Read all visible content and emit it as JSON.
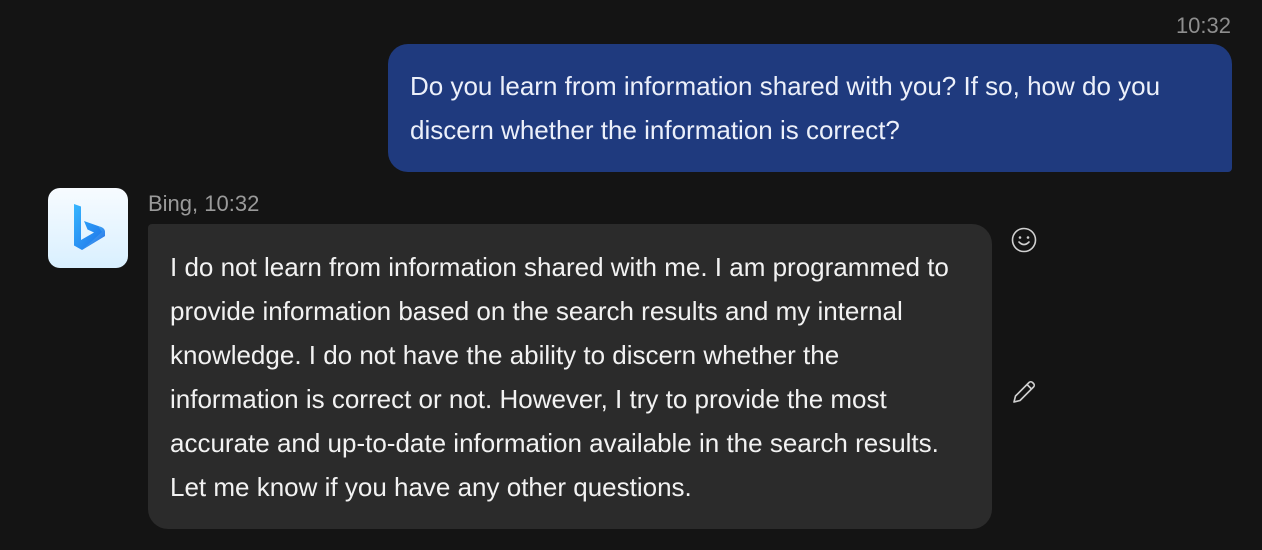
{
  "user_message": {
    "time": "10:32",
    "text": "Do you learn from information shared with you? If so, how do you discern whether the information is correct?"
  },
  "bot_message": {
    "meta": "Bing, 10:32",
    "avatar_icon": "bing-logo-icon",
    "text": "I do not learn from information shared with me. I am programmed to provide information based on the search results and my internal knowledge. I do not have the ability to discern whether the information is correct or not. However, I try to provide the most accurate and up-to-date information available in the search results. Let me know if you have any other questions."
  },
  "actions": {
    "react_icon": "smiley-face-icon",
    "edit_icon": "pencil-icon"
  },
  "colors": {
    "background": "#141414",
    "user_bubble": "#1f3a7e",
    "bot_bubble": "#2b2b2b",
    "bing_logo_gradient": [
      "#1b8ff5",
      "#2f5ce8"
    ]
  }
}
